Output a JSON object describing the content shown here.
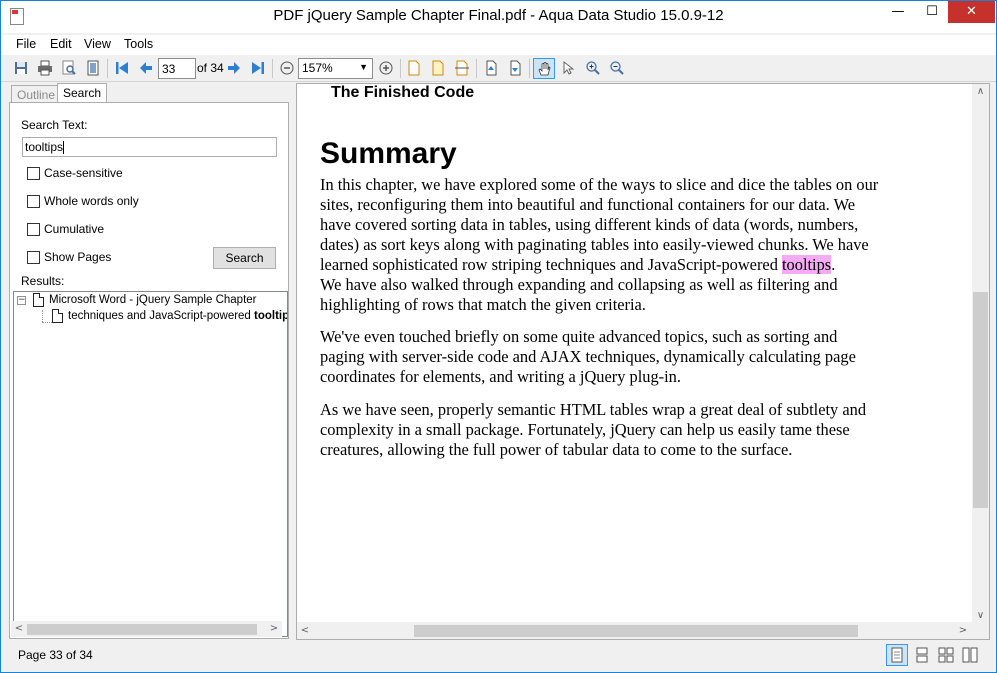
{
  "window": {
    "title": "PDF jQuery Sample Chapter Final.pdf - Aqua Data Studio 15.0.9-12",
    "min_glyph": "—",
    "max_glyph": "☐",
    "close_glyph": "✕"
  },
  "menu": [
    "File",
    "Edit",
    "View",
    "Tools"
  ],
  "toolbar": {
    "page_value": "33",
    "of_label": "of 34",
    "zoom_value": "157%",
    "zoom_arrow": "▼"
  },
  "left_panel": {
    "tabs": [
      "Outline",
      "Search"
    ],
    "search_text_label": "Search Text:",
    "search_value": "tooltips",
    "options": [
      "Case-sensitive",
      "Whole words only",
      "Cumulative",
      "Show Pages"
    ],
    "search_button": "Search",
    "results_label": "Results:",
    "tree": {
      "expander": "−",
      "root": "Microsoft Word - jQuery Sample Chapter",
      "child_prefix": "techniques and JavaScript-powered ",
      "child_match": "tooltips"
    },
    "scroll_left": "<",
    "scroll_right": ">"
  },
  "document": {
    "heading_finished": "The Finished Code",
    "heading_summary": "Summary",
    "para1_before": "In this chapter, we have explored some of the ways to slice and dice the tables on our\nsites, reconfiguring them into beautiful and functional containers for our data. We\nhave covered sorting data in tables, using different kinds of data (words, numbers,\ndates) as sort keys along with paginating tables into easily-viewed chunks. We have\nlearned sophisticated row striping techniques and JavaScript-powered ",
    "para1_match": "tooltips",
    "para1_after": ".\nWe have also walked through expanding and collapsing as well as filtering and\nhighlighting of rows that match the given criteria.",
    "para2": "We've even touched briefly on some quite advanced topics, such as sorting and\npaging with server-side code and AJAX techniques, dynamically calculating page\ncoordinates for elements, and writing a jQuery plug-in.",
    "para3": "As we have seen, properly semantic HTML tables wrap a great deal of subtlety and\ncomplexity in a small package. Fortunately, jQuery can help us easily tame these\ncreatures, allowing the full power of tabular data to come to the surface.",
    "scroll_up": "∧",
    "scroll_down": "∨",
    "scroll_left": "<",
    "scroll_right": ">"
  },
  "status": {
    "page_text": "Page 33 of 34"
  },
  "colors": {
    "highlight": "#f4aaf4",
    "accent": "#3399ff",
    "close_button": "#c7312b"
  }
}
